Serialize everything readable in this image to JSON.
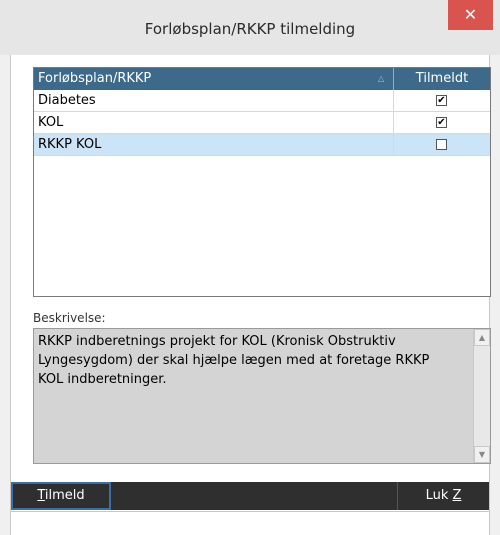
{
  "window": {
    "title": "Forløbsplan/RKKP tilmelding",
    "close_label": "✕"
  },
  "grid": {
    "columns": [
      "Forløbsplan/RKKP",
      "Tilmeldt"
    ],
    "rows": [
      {
        "name": "Diabetes",
        "registered": true
      },
      {
        "name": "KOL",
        "registered": true
      },
      {
        "name": "RKKP KOL",
        "registered": false,
        "selected": true
      }
    ]
  },
  "description": {
    "label": "Beskrivelse:",
    "text": "RKKP indberetnings projekt for KOL (Kronisk Obstruktiv Lyngesygdom) der skal hjælpe lægen med at foretage RKKP KOL indberetninger."
  },
  "buttons": {
    "register_prefix": "T",
    "register_rest": "ilmeld",
    "close_prefix": "Luk ",
    "close_key": "Z"
  },
  "colors": {
    "header": "#3d6a8a",
    "selection": "#cce4f7",
    "toolbar": "#2f2f2f",
    "close": "#d9534f"
  }
}
